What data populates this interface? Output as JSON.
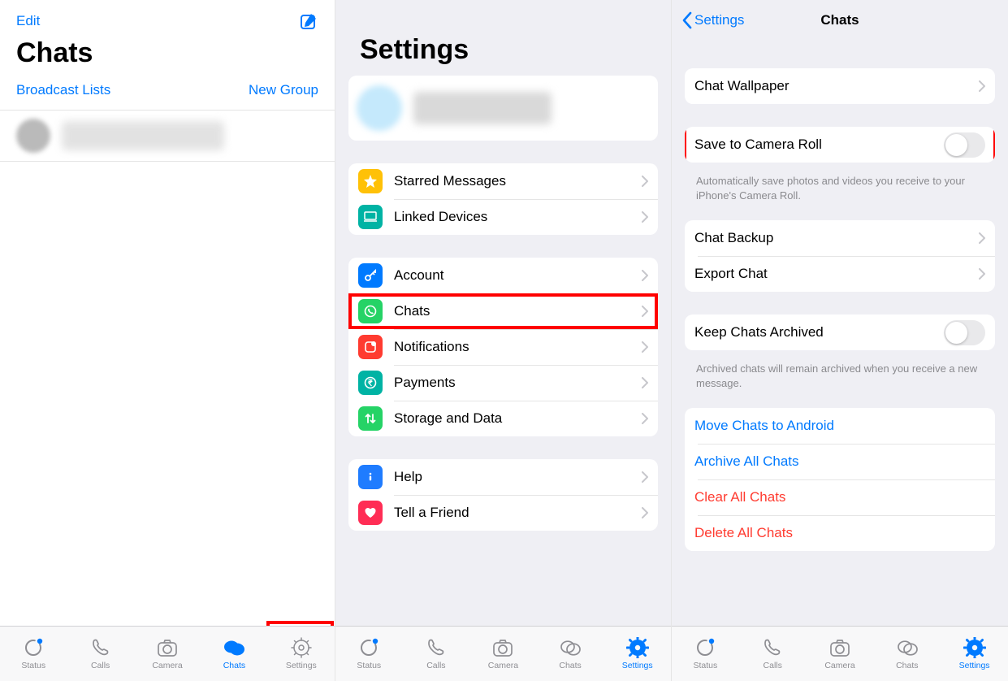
{
  "panel1": {
    "edit": "Edit",
    "title": "Chats",
    "broadcast": "Broadcast Lists",
    "newgroup": "New Group"
  },
  "panel2": {
    "title": "Settings",
    "rows": {
      "starred": "Starred Messages",
      "linked": "Linked Devices",
      "account": "Account",
      "chats": "Chats",
      "notifications": "Notifications",
      "payments": "Payments",
      "storage": "Storage and Data",
      "help": "Help",
      "tell": "Tell a Friend"
    }
  },
  "panel3": {
    "back": "Settings",
    "title": "Chats",
    "wallpaper": "Chat Wallpaper",
    "save": "Save to Camera Roll",
    "save_note": "Automatically save photos and videos you receive to your iPhone's Camera Roll.",
    "backup": "Chat Backup",
    "export": "Export Chat",
    "archive": "Keep Chats Archived",
    "archive_note": "Archived chats will remain archived when you receive a new message.",
    "move": "Move Chats to Android",
    "archive_all": "Archive All Chats",
    "clear": "Clear All Chats",
    "delete": "Delete All Chats"
  },
  "tabs": {
    "status": "Status",
    "calls": "Calls",
    "camera": "Camera",
    "chats": "Chats",
    "settings": "Settings"
  },
  "colors": {
    "yellow": "#ffc107",
    "teal": "#00b3a4",
    "blue": "#007aff",
    "green": "#25d366",
    "red": "#ff3b30",
    "infoblue": "#1f7cff",
    "pink": "#ff2d55"
  }
}
